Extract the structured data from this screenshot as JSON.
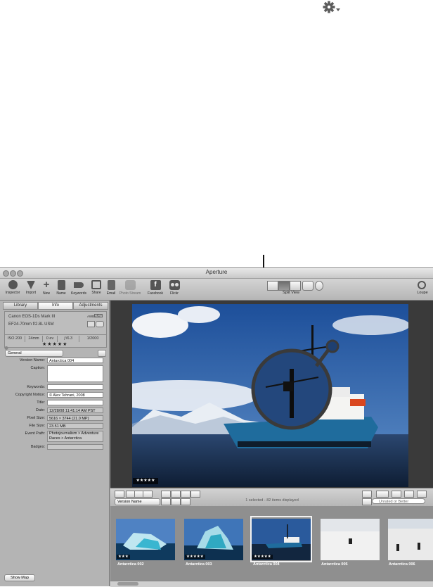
{
  "window": {
    "title": "Aperture"
  },
  "toolbar": {
    "buttons": [
      {
        "label": "Inspector",
        "icon": "info-icon"
      },
      {
        "label": "Import",
        "icon": "import-arrow-icon"
      },
      {
        "label": "New",
        "icon": "plus-icon"
      },
      {
        "label": "Name",
        "icon": "name-icon"
      },
      {
        "label": "Keywords",
        "icon": "keyword-tag-icon"
      },
      {
        "label": "Share",
        "icon": "share-icon"
      },
      {
        "label": "Email",
        "icon": "email-icon"
      },
      {
        "label": "Photo Stream",
        "icon": "photo-stream-icon"
      },
      {
        "label": "Facebook",
        "icon": "facebook-icon"
      },
      {
        "label": "Flickr",
        "icon": "flickr-icon"
      }
    ],
    "view_label": "Split View",
    "loupe_label": "Loupe"
  },
  "inspector": {
    "tabs": [
      "Library",
      "Info",
      "Adjustments"
    ],
    "active_tab": "Info",
    "camera": "Canon EOS-1Ds Mark III",
    "lens": "EF24-70mm f/2.8L USM",
    "badges": [
      "AWB",
      "RAW"
    ],
    "exif": [
      "ISO 200",
      "24mm",
      "0 ev",
      "ƒ/6.3",
      "1/2000"
    ],
    "rating": "★★★★★",
    "metadata_view": "General",
    "fields": [
      {
        "label": "Version Name:",
        "value": "Antarctica 004"
      },
      {
        "label": "Caption:",
        "value": ""
      },
      {
        "label": "Keywords:",
        "value": ""
      },
      {
        "label": "Copyright Notice:",
        "value": "© Alex Tehrani, 2008"
      },
      {
        "label": "Title:",
        "value": ""
      },
      {
        "label": "Date:",
        "value": "12/28/08 11:41:14 AM PST"
      },
      {
        "label": "Pixel Size:",
        "value": "5616 × 3744 (21.0 MP)"
      },
      {
        "label": "File Size:",
        "value": "23.51 MB"
      },
      {
        "label": "Event Path:",
        "value": "Photojournalism > Adventure Races > Antarctica"
      },
      {
        "label": "Badges:",
        "value": ""
      }
    ],
    "show_map": "Show Map"
  },
  "viewer": {
    "rating": "★★★★★"
  },
  "browser": {
    "sort": "Version Name",
    "status": "1 selected - 82 items displayed",
    "filter": "Unrated or Better",
    "thumbnails": [
      {
        "name": "Antarctica 002",
        "stars": "★★★"
      },
      {
        "name": "Antarctica 003",
        "stars": "★★★★★"
      },
      {
        "name": "Antarctica 004",
        "stars": "★★★★★"
      },
      {
        "name": "Antarctica 005",
        "stars": ""
      },
      {
        "name": "Antarctica 006",
        "stars": ""
      }
    ]
  },
  "colors": {
    "accent": "#3b6fb6",
    "sky": "#2f5fa5"
  }
}
